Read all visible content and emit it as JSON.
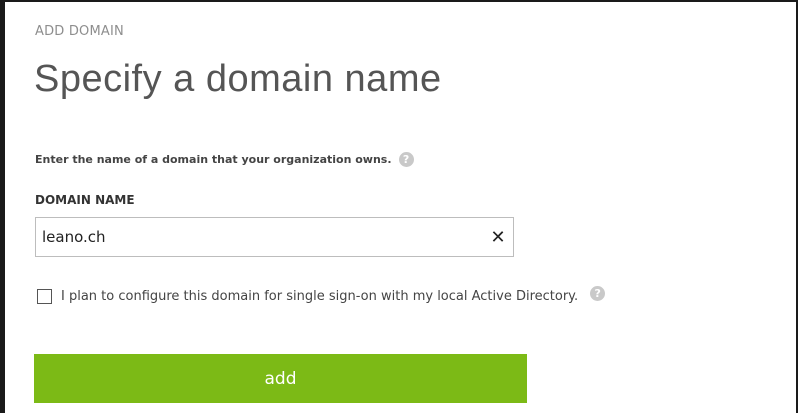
{
  "header": {
    "eyebrow": "ADD DOMAIN",
    "title": "Specify a domain name"
  },
  "form": {
    "intro": "Enter the name of a domain that your organization owns.",
    "help_icon_glyph": "?",
    "domain_label": "DOMAIN NAME",
    "domain_value": "leano.ch",
    "clear_glyph": "✕",
    "sso_checkbox_label": "I plan to configure this domain for single sign-on with my local Active Directory.",
    "sso_checked": false,
    "add_label": "add"
  },
  "colors": {
    "accent_button": "#7cba16",
    "title_text": "#555555",
    "muted_text": "#8e8e8e"
  },
  "icons": {
    "help": "help-icon",
    "clear": "close-icon"
  }
}
